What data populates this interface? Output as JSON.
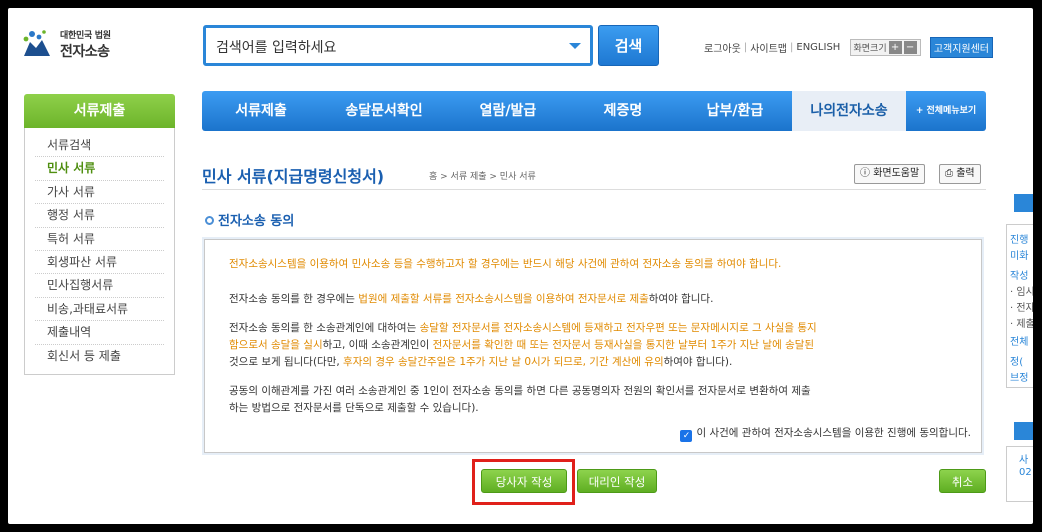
{
  "logo": {
    "org": "대한민국 법원",
    "name": "전자소송"
  },
  "search": {
    "placeholder": "검색어를 입력하세요",
    "button": "검색"
  },
  "util": {
    "logout": "로그아웃",
    "sep": "|",
    "sitemap": "사이트맵",
    "english": "ENGLISH",
    "font_size": "화면크기",
    "plus": "+",
    "minus": "−",
    "support": "고객지원센터"
  },
  "sidebar": {
    "title": "서류제출",
    "items": [
      "서류검색",
      "민사 서류",
      "가사 서류",
      "행정 서류",
      "특허 서류",
      "회생파산 서류",
      "민사집행서류",
      "비송,과태료서류",
      "제출내역",
      "회신서 등 제출"
    ],
    "active_index": 1
  },
  "gnav": {
    "items": [
      "서류제출",
      "송달문서확인",
      "열람/발급",
      "제증명",
      "납부/환급",
      "나의전자소송"
    ],
    "all_menu": "+ 전체메뉴보기",
    "active_index": 5
  },
  "page": {
    "title": "민사 서류(지급명령신청서)",
    "breadcrumb": "홈 > 서류 제출 > 민사 서류",
    "help_button": "화면도움말",
    "print_button": "출력",
    "section_title": "전자소송 동의"
  },
  "content": {
    "p1": "전자소송시스템을 이용하여 민사소송 등을 수행하고자 할 경우에는 반드시 해당 사건에 관하여 전자소송 동의를 하여야 합니다.",
    "p2a": "전자소송 동의를 한 경우에는 ",
    "p2b": "법원에 제출할 서류를 전자소송시스템을 이용하여 전자문서로 제출",
    "p2c": "하여야 합니다.",
    "p3_l1a": "전자소송 동의를 한 소송관계인에 대하여는 ",
    "p3_l1b": "송달할 전자문서를 전자소송시스템에 등재하고 전자우편 또는 문자메시지로 그 사실을 통지",
    "p3_l2a": "함으로서 송달을 실시",
    "p3_l2b": "하고, 이때 소송관계인이 ",
    "p3_l2c": "전자문서를 확인한 때 또는 전자문서 등재사실을 통지한 날부터 1주가 지난 날에 송달된",
    "p3_l3a": "것으로 보게 됩니다(다만, ",
    "p3_l3b": "후자의 경우 송달간주일은 1주가 지난 날 0시가 되므로, 기간 계산에 유의",
    "p3_l3c": "하여야 합니다).",
    "p4_l1": "공동의 이해관계를 가진 여러 소송관계인 중 1인이 전자소송 동의를 하면 다른 공동명의자 전원의 확인서를 전자문서로 변환하여 제출",
    "p4_l2": "하는 방법으로 전자문서를 단독으로 제출할 수 있습니다).",
    "agree": "이 사건에 관하여 전자소송시스템을 이용한 진행에 동의합니다.",
    "agree_checked": true
  },
  "buttons": {
    "party": "당사자 작성",
    "agent": "대리인 작성",
    "cancel": "취소"
  },
  "right": {
    "r1": "진행",
    "r2": "미화",
    "r3": "작성",
    "r4": "· 임시",
    "r5": "· 전자",
    "r6": "· 제출",
    "r7": "전체",
    "r8": "정(",
    "r9": "브정",
    "r10": "사",
    "r11": "02"
  },
  "colors": {
    "blue": "#2a86d8",
    "green": "#6cb42a",
    "orange": "#e08a00",
    "red": "#e0201a"
  }
}
